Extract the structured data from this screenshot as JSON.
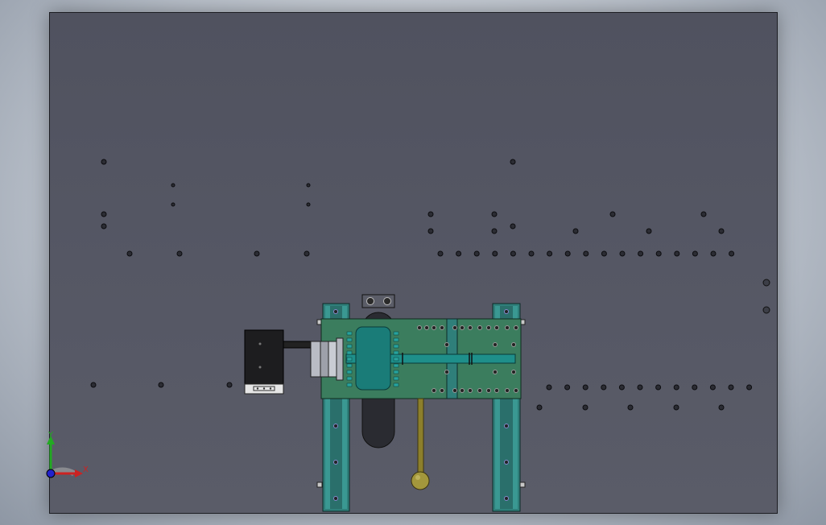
{
  "view": {
    "background_top": "#9aa3b0",
    "plate_color": "#555764",
    "frame_color": "#2f7f7a",
    "board_color": "#3b7d5e",
    "motor_color": "#222222",
    "shaft_color": "#1e8f8a",
    "handle_color": "#8c7f2b"
  },
  "axis_triad": {
    "x_label": "X",
    "y_label": "Y",
    "x_color": "#cc2222",
    "y_color": "#22aa22",
    "z_color": "#2222cc"
  }
}
